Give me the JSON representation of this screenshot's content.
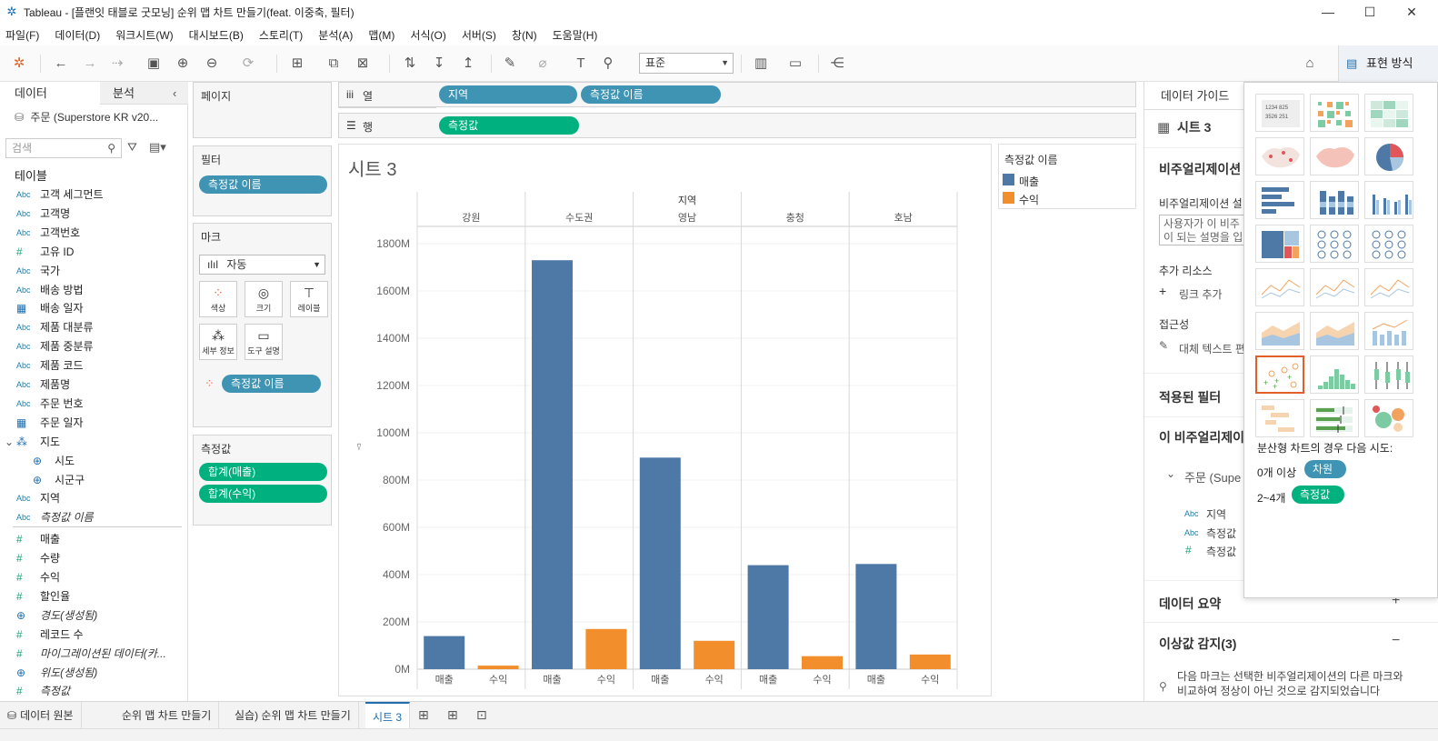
{
  "window": {
    "title": "Tableau - [플랜잇 태블로 굿모닝] 순위 맵 차트 만들기(feat. 이중축, 필터)",
    "minimize": "—",
    "maximize": "☐",
    "close": "✕"
  },
  "menu": [
    "파일(F)",
    "데이터(D)",
    "워크시트(W)",
    "대시보드(B)",
    "스토리(T)",
    "분석(A)",
    "맵(M)",
    "서식(O)",
    "서버(S)",
    "창(N)",
    "도움말(H)"
  ],
  "toolbar": {
    "fit_select": "표준",
    "show_me_label": "표현 방식"
  },
  "data_pane": {
    "tab_data": "데이터",
    "tab_analysis": "분석",
    "datasource": "주문 (Superstore KR v20...",
    "search_placeholder": "검색",
    "tables_header": "테이블",
    "fields": [
      {
        "icon": "Abc",
        "label": "고객 세그먼트"
      },
      {
        "icon": "Abc",
        "label": "고객명"
      },
      {
        "icon": "Abc",
        "label": "고객번호"
      },
      {
        "icon": "#",
        "label": "고유 ID"
      },
      {
        "icon": "Abc",
        "label": "국가"
      },
      {
        "icon": "Abc",
        "label": "배송 방법"
      },
      {
        "icon": "cal",
        "label": "배송 일자"
      },
      {
        "icon": "Abc",
        "label": "제품 대분류"
      },
      {
        "icon": "Abc",
        "label": "제품 중분류"
      },
      {
        "icon": "Abc",
        "label": "제품 코드"
      },
      {
        "icon": "Abc",
        "label": "제품명"
      },
      {
        "icon": "Abc",
        "label": "주문 번호"
      },
      {
        "icon": "cal",
        "label": "주문 일자"
      },
      {
        "icon": "hier",
        "label": "지도"
      },
      {
        "icon": "geo",
        "label": "시도"
      },
      {
        "icon": "geo",
        "label": "시군구"
      },
      {
        "icon": "Abc",
        "label": "지역"
      },
      {
        "icon": "Abc",
        "label": "측정값 이름"
      },
      {
        "icon": "#",
        "label": "매출"
      },
      {
        "icon": "#",
        "label": "수량"
      },
      {
        "icon": "#",
        "label": "수익"
      },
      {
        "icon": "#",
        "label": "할인율"
      },
      {
        "icon": "geo",
        "label": "경도(생성됨)"
      },
      {
        "icon": "#",
        "label": "레코드 수"
      },
      {
        "icon": "#",
        "label": "마이그레이션된 데이터(카..."
      },
      {
        "icon": "geo",
        "label": "위도(생성됨)"
      },
      {
        "icon": "#",
        "label": "측정값"
      }
    ]
  },
  "shelves": {
    "pages": "페이지",
    "filters": "필터",
    "filter_pill": "측정값 이름",
    "marks": "마크",
    "mark_type": "자동",
    "mark_buttons": [
      "색상",
      "크기",
      "레이블",
      "세부 정보",
      "도구 설명"
    ],
    "mark_pill": "측정값 이름",
    "measure_values": "측정값",
    "measure_pills": [
      "합계(매출)",
      "합계(수익)"
    ],
    "columns_label": "열",
    "rows_label": "행",
    "column_pills": [
      "지역",
      "측정값 이름"
    ],
    "row_pills": [
      "측정값"
    ]
  },
  "legend": {
    "title": "측정값 이름",
    "items": [
      "매출",
      "수익"
    ]
  },
  "chart_data": {
    "type": "bar",
    "title": "시트 3",
    "header_label": "지역",
    "categories": [
      "강원",
      "수도권",
      "영남",
      "충청",
      "호남"
    ],
    "sub_categories": [
      "매출",
      "수익"
    ],
    "series": [
      {
        "name": "매출",
        "values": [
          140,
          1730,
          895,
          440,
          445
        ],
        "color": "#4e79a7"
      },
      {
        "name": "수익",
        "values": [
          15,
          170,
          120,
          55,
          62
        ],
        "color": "#f28e2b"
      }
    ],
    "unit": "M",
    "y_ticks": [
      "0M",
      "200M",
      "400M",
      "600M",
      "800M",
      "1000M",
      "1200M",
      "1400M",
      "1600M",
      "1800M"
    ],
    "ylim": [
      0,
      1850
    ]
  },
  "guide": {
    "tab": "데이터 가이드",
    "sheet": "시트 3",
    "viz_desc": "비주얼리제이션 설",
    "viz_desc_label": "비주얼리제이션 설",
    "desc_placeholder": "사용자가 이 비주\n이 되는 설명을 입",
    "extra_resources": "추가 리소스",
    "add_link": "링크 추가",
    "accessibility": "접근성",
    "alt_text": "대체 텍스트 편",
    "applied_filters": "적용된 필터",
    "this_viz": "이 비주얼리제이",
    "order_source": "주문 (Supe",
    "viz_fields": [
      "지역",
      "측정값",
      "측정값"
    ],
    "data_summary": "데이터 요약",
    "outliers": "이상값 감지(3)",
    "outlier_text": "다음 마크는 선택한 비주얼리제이션의 다른 마크와 비교하여 정상이 아닌 것으로 감지되었습니다"
  },
  "show_me": {
    "hint": "분산형 차트의 경우 다음 시도:",
    "req1_count": "0개 이상",
    "req1_pill": "차원",
    "req2_count": "2~4개",
    "req2_pill": "측정값"
  },
  "sheet_tabs": [
    "데이터 원본",
    "순위 맵 차트 만들기",
    "실습) 순위 맵 차트 만들기",
    "시트 3"
  ]
}
